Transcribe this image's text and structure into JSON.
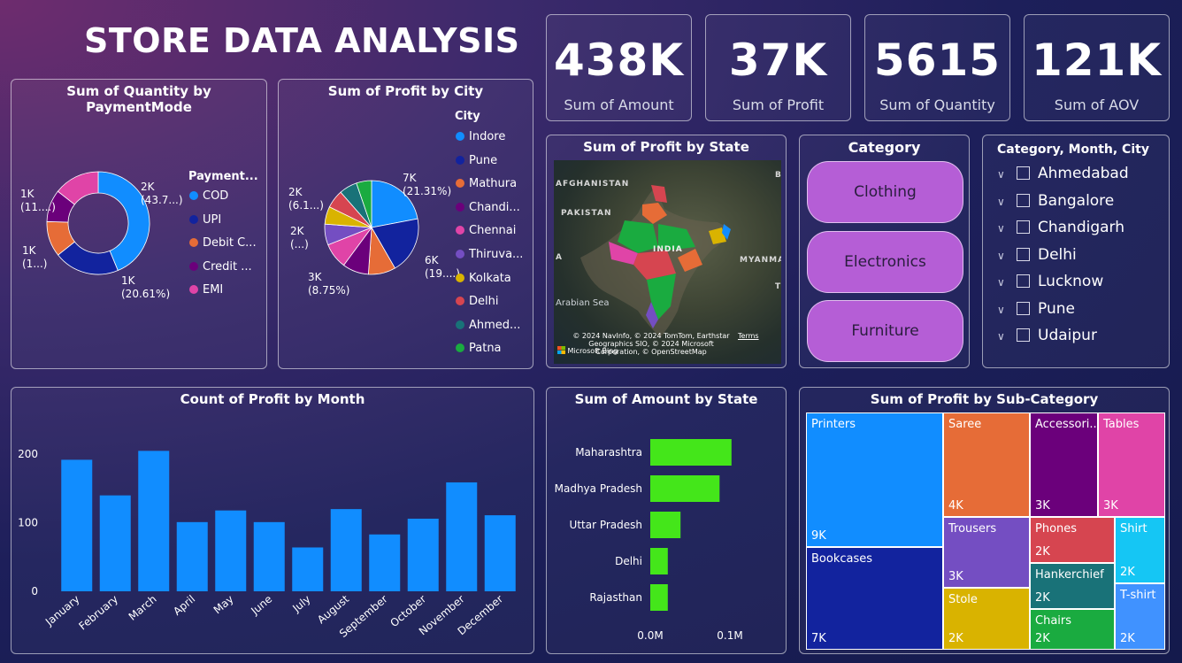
{
  "title": "STORE DATA ANALYSIS",
  "kpis": [
    {
      "value": "438K",
      "label": "Sum of Amount"
    },
    {
      "value": "37K",
      "label": "Sum of Profit"
    },
    {
      "value": "5615",
      "label": "Sum of Quantity"
    },
    {
      "value": "121K",
      "label": "Sum of AOV"
    }
  ],
  "category_slicer": {
    "title": "Category",
    "items": [
      "Clothing",
      "Electronics",
      "Furniture"
    ]
  },
  "hier_slicer": {
    "title": "Category, Month, City",
    "items": [
      "Ahmedabad",
      "Bangalore",
      "Chandigarh",
      "Delhi",
      "Lucknow",
      "Pune",
      "Udaipur"
    ]
  },
  "map_panel": {
    "title": "Sum of Profit by State",
    "labels": {
      "afghanistan": "AFGHANISTAN",
      "pakistan": "PAKISTAN",
      "india": "INDIA",
      "myanmar": "MYANMAR",
      "arabian_sea": "Arabian Sea",
      "a": "A",
      "b": "B",
      "t": "T"
    },
    "attribution": "© 2024 NavInfo, © 2024 TomTom, Earthstar Geographics SIO, © 2024 Microsoft Corporation, © OpenStreetMap",
    "terms": "Terms",
    "brand": "Microsoft Bing"
  },
  "colors": {
    "blue": "#118dff",
    "navy": "#12239e",
    "orange": "#e66c37",
    "purple": "#6b007b",
    "pink": "#e044a7",
    "lavender": "#744ec2",
    "yellow": "#d9b300",
    "red": "#d64550",
    "teal": "#197278",
    "green": "#1aab40",
    "lime": "#44e61a",
    "cyan": "#15c6f4",
    "skyblue": "#4092ff"
  },
  "chart_data": [
    {
      "type": "pie",
      "variant": "donut",
      "title": "Sum of Quantity by PaymentMode",
      "legend_title": "Payment...",
      "legend_labels": [
        "COD",
        "UPI",
        "Debit C...",
        "Credit ...",
        "EMI"
      ],
      "categories": [
        "COD",
        "UPI",
        "Debit Card",
        "Credit Card",
        "EMI"
      ],
      "values": [
        2455,
        1157,
        625,
        570,
        808
      ],
      "colors": [
        "#118dff",
        "#12239e",
        "#e66c37",
        "#6b007b",
        "#e044a7"
      ],
      "data_labels": [
        {
          "line1": "2K",
          "line2": "(43.7...)"
        },
        {
          "line1": "1K",
          "line2": "(20.61%)"
        },
        {
          "line1": "1K",
          "line2": "(1...)"
        },
        {
          "line1": "1K",
          "line2": "(11....)"
        }
      ]
    },
    {
      "type": "pie",
      "title": "Sum of Profit by City",
      "legend_title": "City",
      "legend_labels": [
        "Indore",
        "Pune",
        "Mathura",
        "Chandi...",
        "Chennai",
        "Thiruva...",
        "Kolkata",
        "Delhi",
        "Ahmed...",
        "Patna"
      ],
      "categories": [
        "Indore",
        "Pune",
        "Mathura",
        "Chandigarh",
        "Chennai",
        "Thiruvananthapuram",
        "Kolkata",
        "Delhi",
        "Ahmedabad",
        "Patna"
      ],
      "values": [
        7.97,
        7.12,
        3.4,
        3.27,
        3.2,
        2.6,
        2.2,
        2.28,
        2.25,
        1.9
      ],
      "colors": [
        "#118dff",
        "#12239e",
        "#e66c37",
        "#6b007b",
        "#e044a7",
        "#744ec2",
        "#d9b300",
        "#d64550",
        "#197278",
        "#1aab40"
      ],
      "data_labels": [
        {
          "line1": "7K",
          "line2": "(21.31%)"
        },
        {
          "line1": "6K",
          "line2": "(19....)"
        },
        {
          "line1": "3K",
          "line2": "(8.75%)"
        },
        {
          "line1": "2K",
          "line2": "(...)"
        },
        {
          "line1": "2K",
          "line2": "(6.1...)"
        }
      ]
    },
    {
      "type": "bar",
      "title": "Count of Profit by Month",
      "categories": [
        "January",
        "February",
        "March",
        "April",
        "May",
        "June",
        "July",
        "August",
        "September",
        "October",
        "November",
        "December"
      ],
      "values": [
        192,
        140,
        205,
        101,
        118,
        101,
        64,
        120,
        83,
        106,
        159,
        111
      ],
      "yticks": [
        "0",
        "100",
        "200"
      ],
      "ylim": [
        0,
        230
      ],
      "color": "#118dff"
    },
    {
      "type": "bar",
      "orientation": "horizontal",
      "title": "Sum of Amount by State",
      "categories": [
        "Maharashtra",
        "Madhya Pradesh",
        "Uttar Pradesh",
        "Delhi",
        "Rajasthan"
      ],
      "values": [
        0.102,
        0.087,
        0.038,
        0.022,
        0.022
      ],
      "xticks": [
        "0.0M",
        "0.1M"
      ],
      "xlim": [
        0,
        0.1
      ],
      "color": "#44e61a"
    },
    {
      "type": "treemap",
      "title": "Sum of Profit by Sub-Category",
      "items": [
        {
          "name": "Printers",
          "label": "9K",
          "color": "#118dff"
        },
        {
          "name": "Bookcases",
          "label": "7K",
          "color": "#12239e"
        },
        {
          "name": "Saree",
          "label": "4K",
          "color": "#e66c37"
        },
        {
          "name": "Accessori...",
          "label": "3K",
          "color": "#6b007b"
        },
        {
          "name": "Tables",
          "label": "3K",
          "color": "#e044a7"
        },
        {
          "name": "Trousers",
          "label": "3K",
          "color": "#744ec2"
        },
        {
          "name": "Phones",
          "label": "2K",
          "color": "#d64550"
        },
        {
          "name": "Shirt",
          "label": "2K",
          "color": "#15c6f4"
        },
        {
          "name": "Hankerchief",
          "label": "2K",
          "color": "#197278"
        },
        {
          "name": "T-shirt",
          "label": "2K",
          "color": "#4092ff"
        },
        {
          "name": "Stole",
          "label": "2K",
          "color": "#d9b300"
        },
        {
          "name": "Chairs",
          "label": "2K",
          "color": "#1aab40"
        }
      ]
    }
  ]
}
